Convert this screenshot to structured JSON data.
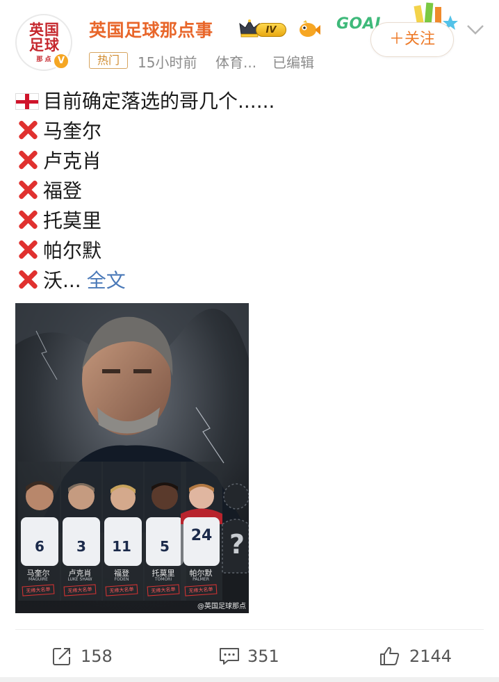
{
  "post": {
    "username": "英国足球那点事",
    "avatar_text": "英国足球",
    "avatar_sub": "那 点",
    "rank": "IV",
    "goal_text": "GOAL",
    "follow_label": "＋关注",
    "hot_tag": "热门",
    "time": "15小时前",
    "source": "体育...",
    "edited": "已编辑",
    "lines": [
      "目前确定落选的哥几个......",
      "马奎尔",
      "卢克肖",
      "福登",
      "托莫里",
      "帕尔默",
      "沃..."
    ],
    "expand_label": "全文",
    "image": {
      "watermark": "@英国足球那点",
      "players": [
        {
          "name": "马奎尔",
          "en": "MAGUIRE",
          "number": "6",
          "stamp": "无缘大名单"
        },
        {
          "name": "卢克肖",
          "en": "LUKE SHAW",
          "number": "3",
          "stamp": "无缘大名单"
        },
        {
          "name": "福登",
          "en": "FODEN",
          "number": "11",
          "stamp": "无缘大名单"
        },
        {
          "name": "托莫里",
          "en": "TOMORI",
          "number": "5",
          "stamp": "无缘大名单"
        },
        {
          "name": "帕尔默",
          "en": "PALMER",
          "number": "24",
          "stamp": "无缘大名单"
        }
      ],
      "mystery": "?"
    }
  },
  "actions": {
    "repost": "158",
    "comment": "351",
    "like": "2144"
  },
  "colors": {
    "username": "#e8662a",
    "link": "#4a79b8",
    "meta": "#8c8c8c",
    "cross": "#e0312f"
  }
}
